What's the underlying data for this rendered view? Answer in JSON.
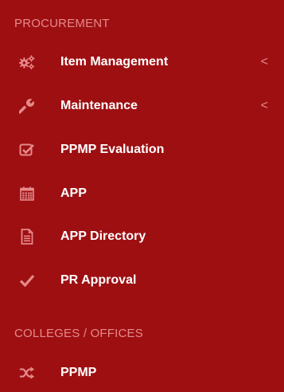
{
  "sections": {
    "procurement": "PROCUREMENT",
    "colleges": "COLLEGES / OFFICES"
  },
  "items": [
    {
      "label": "Item Management",
      "icon": "cogs-icon",
      "has_submenu": true
    },
    {
      "label": "Maintenance",
      "icon": "wrench-icon",
      "has_submenu": true
    },
    {
      "label": "PPMP Evaluation",
      "icon": "check-square-icon",
      "has_submenu": false
    },
    {
      "label": "APP",
      "icon": "calendar-icon",
      "has_submenu": false
    },
    {
      "label": "APP Directory",
      "icon": "file-text-icon",
      "has_submenu": false
    },
    {
      "label": "PR Approval",
      "icon": "check-icon",
      "has_submenu": false
    },
    {
      "label": "PPMP",
      "icon": "random-icon",
      "has_submenu": false
    }
  ],
  "chevron": "<",
  "colors": {
    "background": "#9e0f12",
    "header_text": "#e58a8a",
    "icon": "#e58a8a",
    "label": "#ffffff"
  }
}
